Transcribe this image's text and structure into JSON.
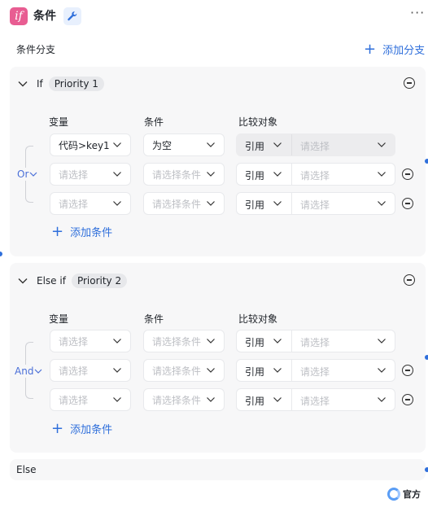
{
  "header": {
    "logo_text": "if",
    "title": "条件",
    "more": "···"
  },
  "section": {
    "label": "条件分支",
    "add_branch_label": "添加分支"
  },
  "columns": {
    "variable": "变量",
    "condition": "条件",
    "compare": "比较对象"
  },
  "branches": [
    {
      "label": "If",
      "priority": "Priority 1",
      "logic": "Or",
      "rows": [
        {
          "variable": "代码>key1",
          "condition": "为空",
          "ref": "引用",
          "value_placeholder": "请选择",
          "disabled_compare": true
        },
        {
          "variable_placeholder": "请选择",
          "condition_placeholder": "请选择条件",
          "ref": "引用",
          "value_placeholder": "请选择"
        },
        {
          "variable_placeholder": "请选择",
          "condition_placeholder": "请选择条件",
          "ref": "引用",
          "value_placeholder": "请选择"
        }
      ],
      "add_condition_label": "添加条件"
    },
    {
      "label": "Else if",
      "priority": "Priority 2",
      "logic": "And",
      "rows": [
        {
          "variable_placeholder": "请选择",
          "condition_placeholder": "请选择条件",
          "ref": "引用",
          "value_placeholder": "请选择"
        },
        {
          "variable_placeholder": "请选择",
          "condition_placeholder": "请选择条件",
          "ref": "引用",
          "value_placeholder": "请选择"
        },
        {
          "variable_placeholder": "请选择",
          "condition_placeholder": "请选择条件",
          "ref": "引用",
          "value_placeholder": "请选择"
        }
      ],
      "add_condition_label": "添加条件"
    }
  ],
  "else_label": "Else",
  "footer": {
    "official_label": "官方"
  },
  "colors": {
    "accent": "#2f6fdb",
    "logo_bg": "#e85d92",
    "card_bg": "#f7f7f8",
    "logic_text": "#4a6fd8"
  },
  "icons": [
    "if-logo-icon",
    "wrench-icon",
    "more-icon",
    "plus-icon",
    "chevron-down-icon",
    "minus-circle-icon",
    "official-logo-icon"
  ]
}
